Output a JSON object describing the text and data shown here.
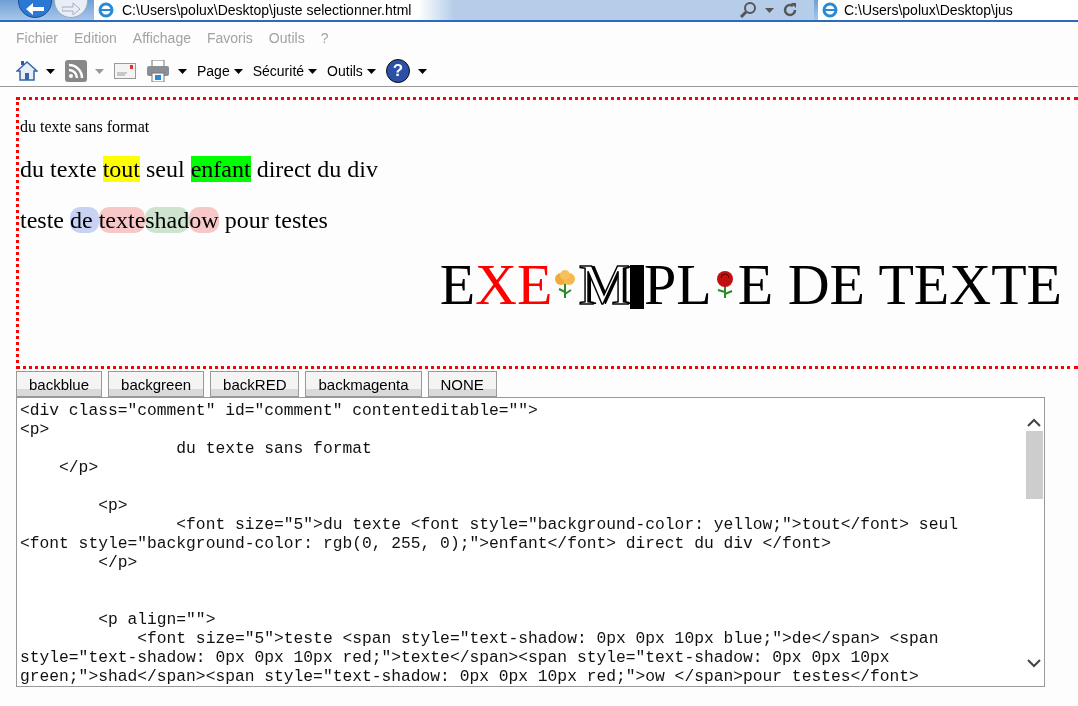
{
  "browser": {
    "address": "C:\\Users\\polux\\Desktop\\juste selectionner.html",
    "tab_title": "C:\\Users\\polux\\Desktop\\jus"
  },
  "menu": [
    "Fichier",
    "Edition",
    "Affichage",
    "Favoris",
    "Outils",
    "?"
  ],
  "toolbar": [
    {
      "kind": "home"
    },
    {
      "kind": "feed"
    },
    {
      "kind": "mail"
    },
    {
      "kind": "print"
    },
    {
      "kind": "menu",
      "label": "Page"
    },
    {
      "kind": "menu",
      "label": "Sécurité"
    },
    {
      "kind": "menu",
      "label": "Outils"
    },
    {
      "kind": "help",
      "label": "?"
    }
  ],
  "editable": {
    "plain": "du texte sans format",
    "highlight_line": [
      {
        "text": "du texte "
      },
      {
        "text": "tout",
        "color": "#ffff00"
      },
      {
        "text": " seul "
      },
      {
        "text": "enfant",
        "color": "#00ff00"
      },
      {
        "text": " direct du div"
      }
    ],
    "shadow_line": [
      {
        "text": "teste "
      },
      {
        "text": "de ",
        "color": "#c8d2f2"
      },
      {
        "text": "texte",
        "color": "#f8c8c8"
      },
      {
        "text": "shad",
        "color": "#cfe4cf"
      },
      {
        "text": "ow",
        "color": "#f8c8c8"
      },
      {
        "text": " pour testes"
      }
    ],
    "heading": [
      {
        "kind": "letters",
        "text": "E"
      },
      {
        "kind": "red-letters",
        "text": "XE"
      },
      {
        "kind": "flower"
      },
      {
        "kind": "outlined-letters",
        "text": "M"
      },
      {
        "kind": "barred-letters",
        "text": "P"
      },
      {
        "kind": "letters",
        "text": "L"
      },
      {
        "kind": "rose"
      },
      {
        "kind": "letters",
        "text": "E DE TEXTE"
      }
    ]
  },
  "buttons": [
    "backblue",
    "backgreen",
    "backRED",
    "backmagenta",
    "NONE"
  ],
  "source_code": "<div class=\"comment\" id=\"comment\" contenteditable=\"\">\n<p>\n                du texte sans format\n    </p>\n\n        <p>\n                <font size=\"5\">du texte <font style=\"background-color: yellow;\">tout</font> seul\n<font style=\"background-color: rgb(0, 255, 0);\">enfant</font> direct du div </font>\n        </p>\n\n\n        <p align=\"\">\n            <font size=\"5\">teste <span style=\"text-shadow: 0px 0px 10px blue;\">de</span> <span\nstyle=\"text-shadow: 0px 0px 10px red;\">texte</span><span style=\"text-shadow: 0px 0px 10px\ngreen;\">shad</span><span style=\"text-shadow: 0px 0px 10px red;\">ow </span>pour testes</font>"
}
